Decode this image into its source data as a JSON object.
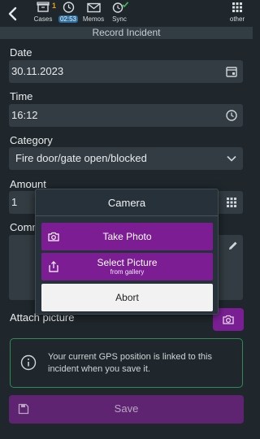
{
  "header": {
    "nav": [
      {
        "name": "cases",
        "label": "Cases",
        "badge": "1"
      },
      {
        "name": "clock",
        "label": "02:53"
      },
      {
        "name": "memos",
        "label": "Memos"
      },
      {
        "name": "sync",
        "label": "Sync"
      }
    ],
    "other_label": "other",
    "subtitle": "Record Incident"
  },
  "form": {
    "date_label": "Date",
    "date_value": "30.11.2023",
    "time_label": "Time",
    "time_value": "16:12",
    "category_label": "Category",
    "category_value": "Fire door/gate open/blocked",
    "amount_label": "Amount",
    "amount_value": "1",
    "comment_label": "Comm",
    "attach_label": "Attach picture",
    "gps_text": "Your current GPS position is linked to this incident when you save it.",
    "save_label": "Save"
  },
  "dialog": {
    "title": "Camera",
    "take_photo": "Take Photo",
    "select_picture": "Select Picture",
    "select_picture_sub": "from gallery",
    "abort": "Abort"
  },
  "colors": {
    "background": "#1f272c",
    "field": "#323c42",
    "accent_purple": "#7c1d94",
    "gps_border": "#2f8a55",
    "badge_orange": "#e5a019"
  }
}
